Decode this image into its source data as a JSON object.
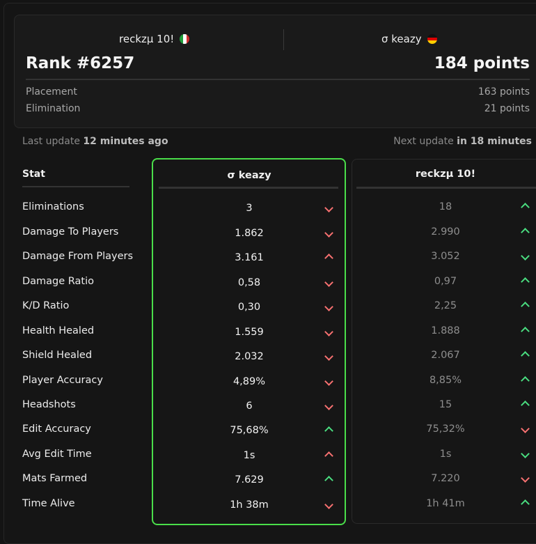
{
  "match": {
    "player_left": {
      "name": "reckzµ 10!",
      "flag_icon": "italy-flag-icon"
    },
    "player_right": {
      "name": "σ keazy",
      "flag_icon": "germany-flag-icon"
    },
    "rank": "Rank #6257",
    "points_total": "184 points",
    "breakdown": [
      {
        "label": "Placement",
        "value": "163 points"
      },
      {
        "label": "Elimination",
        "value": "21 points"
      }
    ]
  },
  "updates": {
    "last_prefix": "Last update",
    "last_value": "12 minutes ago",
    "next_prefix": "Next update",
    "next_value": "in 18 minutes"
  },
  "table": {
    "stat_header": "Stat",
    "col_me_title": "σ keazy",
    "col_opp_title": "reckzµ 10!",
    "rows": [
      {
        "stat": "Eliminations",
        "me": "3",
        "me_dir": "down",
        "opp": "18",
        "opp_dir": "up"
      },
      {
        "stat": "Damage To Players",
        "me": "1.862",
        "me_dir": "down",
        "opp": "2.990",
        "opp_dir": "up"
      },
      {
        "stat": "Damage From Players",
        "me": "3.161",
        "me_dir": "up-red",
        "opp": "3.052",
        "opp_dir": "down-green"
      },
      {
        "stat": "Damage Ratio",
        "me": "0,58",
        "me_dir": "down",
        "opp": "0,97",
        "opp_dir": "up"
      },
      {
        "stat": "K/D Ratio",
        "me": "0,30",
        "me_dir": "down",
        "opp": "2,25",
        "opp_dir": "up"
      },
      {
        "stat": "Health Healed",
        "me": "1.559",
        "me_dir": "down",
        "opp": "1.888",
        "opp_dir": "up"
      },
      {
        "stat": "Shield Healed",
        "me": "2.032",
        "me_dir": "down",
        "opp": "2.067",
        "opp_dir": "up"
      },
      {
        "stat": "Player Accuracy",
        "me": "4,89%",
        "me_dir": "down",
        "opp": "8,85%",
        "opp_dir": "up"
      },
      {
        "stat": "Headshots",
        "me": "6",
        "me_dir": "down",
        "opp": "15",
        "opp_dir": "up"
      },
      {
        "stat": "Edit Accuracy",
        "me": "75,68%",
        "me_dir": "up",
        "opp": "75,32%",
        "opp_dir": "down"
      },
      {
        "stat": "Avg Edit Time",
        "me": "1s",
        "me_dir": "up-red",
        "opp": "1s",
        "opp_dir": "down-green"
      },
      {
        "stat": "Mats Farmed",
        "me": "7.629",
        "me_dir": "up",
        "opp": "7.220",
        "opp_dir": "down"
      },
      {
        "stat": "Time Alive",
        "me": "1h 38m",
        "me_dir": "down",
        "opp": "1h 41m",
        "opp_dir": "up"
      }
    ]
  },
  "colors": {
    "highlight_border": "#4ade4a",
    "better": "#4ade80",
    "worse": "#f87171"
  }
}
